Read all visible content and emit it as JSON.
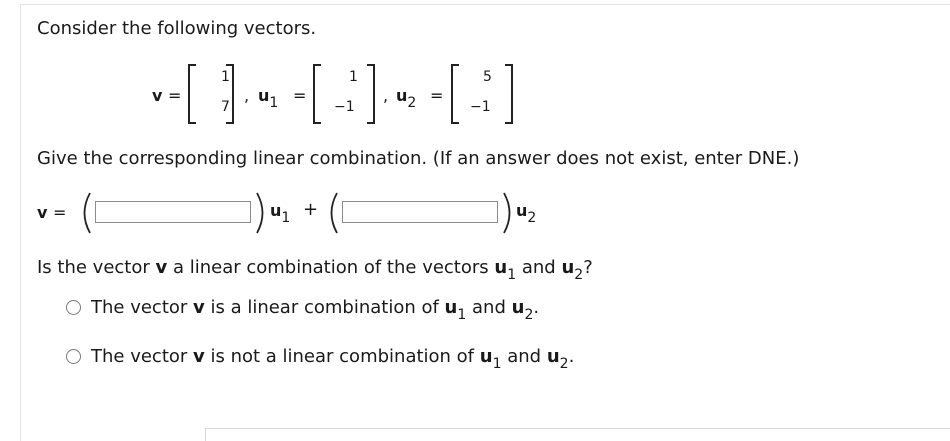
{
  "question": {
    "prompt": "Consider the following vectors.",
    "vectors": {
      "v": {
        "name": "v",
        "entries": [
          "1",
          "7"
        ]
      },
      "u1": {
        "name": "u",
        "sub": "1",
        "entries": [
          "1",
          "−1"
        ]
      },
      "u2": {
        "name": "u",
        "sub": "2",
        "entries": [
          "5",
          "−1"
        ]
      },
      "equals": "=",
      "comma": ","
    },
    "instruction": "Give the corresponding linear combination. (If an answer does not exist, enter DNE.)",
    "combination": {
      "lhs": "v",
      "equals": "=",
      "plus": "+",
      "u_label": "u",
      "sub1": "1",
      "sub2": "2",
      "coef1_value": "",
      "coef2_value": ""
    },
    "part2": {
      "q_pre": "Is the vector ",
      "q_v": "v",
      "q_mid": " a linear combination of the vectors ",
      "q_u": "u",
      "q_sub1": "1",
      "q_and": " and ",
      "q_sub2": "2",
      "q_end": "?"
    },
    "options": [
      {
        "pre": "The vector ",
        "v": "v",
        "mid": " is a linear combination of ",
        "u": "u",
        "sub1": "1",
        "and": " and ",
        "sub2": "2",
        "end": "."
      },
      {
        "pre": "The vector ",
        "v": "v",
        "mid": " is not a linear combination of ",
        "u": "u",
        "sub1": "1",
        "and": " and ",
        "sub2": "2",
        "end": "."
      }
    ]
  }
}
